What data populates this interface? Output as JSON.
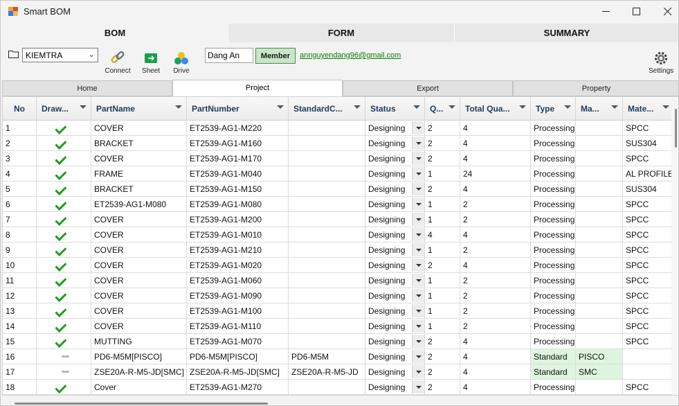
{
  "window": {
    "title": "Smart BOM",
    "minimize": "—",
    "maximize": "☐",
    "close": "✕"
  },
  "main_tabs": [
    {
      "label": "BOM"
    },
    {
      "label": "FORM"
    },
    {
      "label": "SUMMARY"
    }
  ],
  "toolbar": {
    "project_combo": "KIEMTRA",
    "connect_label": "Connect",
    "sheet_label": "Sheet",
    "drive_label": "Drive",
    "user_name": "Dang An",
    "member_label": "Member",
    "email": "annguyendang96@gmail.com",
    "settings_label": "Settings"
  },
  "sub_tabs": [
    {
      "label": "Home"
    },
    {
      "label": "Project"
    },
    {
      "label": "Export"
    },
    {
      "label": "Property"
    }
  ],
  "columns": [
    "No",
    "Draw...",
    "PartName",
    "PartNumber",
    "StandardC...",
    "Status",
    "Q...",
    "Total Qua...",
    "Type",
    "Ma...",
    "Mate..."
  ],
  "rows": [
    {
      "no": "1",
      "draw": "check",
      "part_name": "COVER",
      "part_number": "ET2539-AG1-M220",
      "standard": "",
      "status": "Designing",
      "q": "2",
      "total": "4",
      "type": "Processing",
      "maker": "",
      "material": "SPCC"
    },
    {
      "no": "2",
      "draw": "check",
      "part_name": "BRACKET",
      "part_number": "ET2539-AG1-M160",
      "standard": "",
      "status": "Designing",
      "q": "2",
      "total": "4",
      "type": "Processing",
      "maker": "",
      "material": "SUS304"
    },
    {
      "no": "3",
      "draw": "check",
      "part_name": "COVER",
      "part_number": "ET2539-AG1-M170",
      "standard": "",
      "status": "Designing",
      "q": "2",
      "total": "4",
      "type": "Processing",
      "maker": "",
      "material": "SPCC"
    },
    {
      "no": "4",
      "draw": "check",
      "part_name": "FRAME",
      "part_number": "ET2539-AG1-M040",
      "standard": "",
      "status": "Designing",
      "q": "1",
      "total": "24",
      "type": "Processing",
      "maker": "",
      "material": "AL PROFILE"
    },
    {
      "no": "5",
      "draw": "check",
      "part_name": "BRACKET",
      "part_number": "ET2539-AG1-M150",
      "standard": "",
      "status": "Designing",
      "q": "2",
      "total": "4",
      "type": "Processing",
      "maker": "",
      "material": "SUS304"
    },
    {
      "no": "6",
      "draw": "check",
      "part_name": "ET2539-AG1-M080",
      "part_number": "ET2539-AG1-M080",
      "standard": "",
      "status": "Designing",
      "q": "1",
      "total": "2",
      "type": "Processing",
      "maker": "",
      "material": "SPCC"
    },
    {
      "no": "7",
      "draw": "check",
      "part_name": "COVER",
      "part_number": "ET2539-AG1-M200",
      "standard": "",
      "status": "Designing",
      "q": "1",
      "total": "2",
      "type": "Processing",
      "maker": "",
      "material": "SPCC"
    },
    {
      "no": "8",
      "draw": "check",
      "part_name": "COVER",
      "part_number": "ET2539-AG1-M010",
      "standard": "",
      "status": "Designing",
      "q": "4",
      "total": "4",
      "type": "Processing",
      "maker": "",
      "material": "SPCC"
    },
    {
      "no": "9",
      "draw": "check",
      "part_name": "COVER",
      "part_number": "ET2539-AG1-M210",
      "standard": "",
      "status": "Designing",
      "q": "1",
      "total": "2",
      "type": "Processing",
      "maker": "",
      "material": "SPCC"
    },
    {
      "no": "10",
      "draw": "check",
      "part_name": "COVER",
      "part_number": "ET2539-AG1-M020",
      "standard": "",
      "status": "Designing",
      "q": "2",
      "total": "4",
      "type": "Processing",
      "maker": "",
      "material": "SPCC"
    },
    {
      "no": "11",
      "draw": "check",
      "part_name": "COVER",
      "part_number": "ET2539-AG1-M060",
      "standard": "",
      "status": "Designing",
      "q": "1",
      "total": "2",
      "type": "Processing",
      "maker": "",
      "material": "SPCC"
    },
    {
      "no": "12",
      "draw": "check",
      "part_name": "COVER",
      "part_number": "ET2539-AG1-M090",
      "standard": "",
      "status": "Designing",
      "q": "1",
      "total": "2",
      "type": "Processing",
      "maker": "",
      "material": "SPCC"
    },
    {
      "no": "13",
      "draw": "check",
      "part_name": "COVER",
      "part_number": "ET2539-AG1-M100",
      "standard": "",
      "status": "Designing",
      "q": "1",
      "total": "2",
      "type": "Processing",
      "maker": "",
      "material": "SPCC"
    },
    {
      "no": "14",
      "draw": "check",
      "part_name": "COVER",
      "part_number": "ET2539-AG1-M110",
      "standard": "",
      "status": "Designing",
      "q": "1",
      "total": "2",
      "type": "Processing",
      "maker": "",
      "material": "SPCC"
    },
    {
      "no": "15",
      "draw": "check",
      "part_name": "MUTTING",
      "part_number": "ET2539-AG1-M070",
      "standard": "",
      "status": "Designing",
      "q": "2",
      "total": "4",
      "type": "Processing",
      "maker": "",
      "material": "SPCC"
    },
    {
      "no": "16",
      "draw": "dash",
      "part_name": "PD6-M5M[PISCO]",
      "part_number": "PD6-M5M[PISCO]",
      "standard": "PD6-M5M",
      "status": "Designing",
      "q": "2",
      "total": "4",
      "type": "Standard",
      "maker": "PISCO",
      "material": ""
    },
    {
      "no": "17",
      "draw": "dash",
      "part_name": "ZSE20A-R-M5-JD[SMC]",
      "part_number": "ZSE20A-R-M5-JD[SMC]",
      "standard": "ZSE20A-R-M5-JD",
      "status": "Designing",
      "q": "2",
      "total": "4",
      "type": "Standard",
      "maker": "SMC",
      "material": ""
    },
    {
      "no": "18",
      "draw": "check",
      "part_name": "Cover",
      "part_number": "ET2539-AG1-M270",
      "standard": "",
      "status": "Designing",
      "q": "2",
      "total": "4",
      "type": "Processing",
      "maker": "",
      "material": "SPCC"
    }
  ]
}
